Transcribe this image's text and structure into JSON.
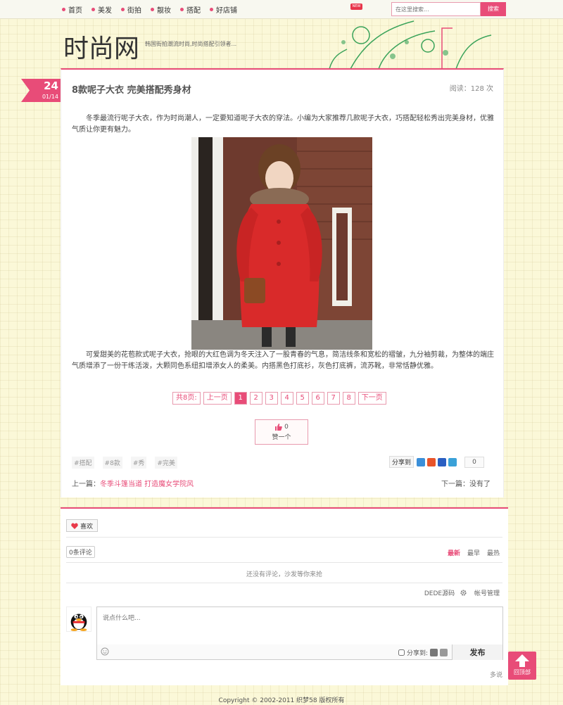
{
  "nav": {
    "items": [
      "首页",
      "美发",
      "街拍",
      "靓妆",
      "搭配",
      "好店铺"
    ],
    "new_badge": "NEW"
  },
  "search": {
    "placeholder": "在这里搜索...",
    "button": "搜索"
  },
  "header": {
    "logo": "时尚网",
    "slogan": "韩国街拍潮流时尚,时尚搭配引领者..."
  },
  "date": {
    "day": "24",
    "month_day": "01/14"
  },
  "article": {
    "title": "8款呢子大衣 完美搭配秀身材",
    "views": "阅读：128 次",
    "para1": "冬季最流行呢子大衣，作为时尚潮人，一定要知道呢子大衣的穿法。小编为大家推荐几款呢子大衣，巧搭配轻松秀出完美身材，优雅气质让你更有魅力。",
    "para2": "可爱甜美的花苞款式呢子大衣，抢眼的大红色调为冬天注入了一股青春的气息，简洁线条和宽松的褶皱，九分袖剪裁，为整体的端庄气质增添了一份干练活泼，大颗同色系纽扣增添女人的柔美。内搭黑色打底衫，灰色打底裤，流苏靴，非常恬静优雅。"
  },
  "pagination": {
    "total": "共8页:",
    "prev": "上一页",
    "pages": [
      "1",
      "2",
      "3",
      "4",
      "5",
      "6",
      "7",
      "8"
    ],
    "next": "下一页"
  },
  "like": {
    "count": "0",
    "label": "赞一个"
  },
  "tags": [
    "#搭配",
    "#8款",
    "#秀",
    "#完美"
  ],
  "share": {
    "label": "分享到",
    "count": "0"
  },
  "nav_links": {
    "prev_label": "上一篇：",
    "prev_title": "冬季斗篷当道 打造魔女学院风",
    "next_label": "下一篇：",
    "next_title": "没有了"
  },
  "comments": {
    "fav": "喜欢",
    "count": "0条评论",
    "sort": [
      "最新",
      "最早",
      "最热"
    ],
    "empty": "还没有评论，沙发等你来抢",
    "account": [
      "DEDE源码",
      "帐号管理"
    ],
    "placeholder": "说点什么吧...",
    "share_to": "分享到:",
    "publish": "发布",
    "provider": "多说"
  },
  "back_top": "回顶部",
  "copyright": "Copyright © 2002-2011 织梦58 版权所有",
  "colors": {
    "accent": "#e84c78",
    "background": "#fbf8d8"
  }
}
